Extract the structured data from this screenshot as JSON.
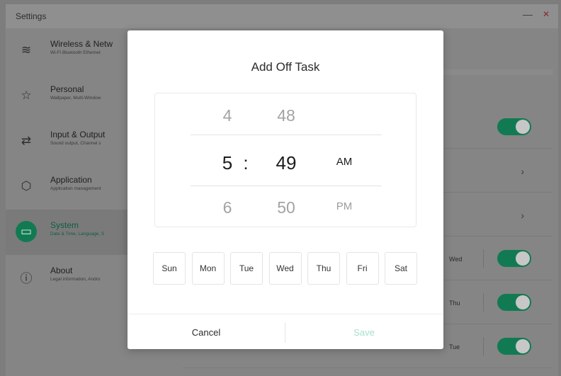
{
  "window": {
    "title": "Settings",
    "minimize_glyph": "—",
    "close_glyph": "✕"
  },
  "sidebar": {
    "items": [
      {
        "icon": "wifi-icon",
        "glyph": "≋",
        "label": "Wireless & Netw",
        "subtitle": "Wi-Fi Bluetooth Ethernet"
      },
      {
        "icon": "star-icon",
        "glyph": "☆",
        "label": "Personal",
        "subtitle": "Wallpaper, Multi-Window"
      },
      {
        "icon": "input-output-icon",
        "glyph": "⇄",
        "label": "Input & Output",
        "subtitle": "Sound output, Channel s"
      },
      {
        "icon": "application-icon",
        "glyph": "⬡",
        "label": "Application",
        "subtitle": "Application management"
      },
      {
        "icon": "monitor-icon",
        "glyph": "▭",
        "label": "System",
        "subtitle": "Date & Time, Language, S",
        "active": true
      },
      {
        "icon": "info-icon",
        "glyph": "ⓘ",
        "label": "About",
        "subtitle": "Legal information, Andro"
      }
    ]
  },
  "content": {
    "rows": [
      {
        "type": "toggle",
        "on": true
      },
      {
        "type": "chevron",
        "glyph": "›"
      },
      {
        "type": "chevron",
        "glyph": "›"
      },
      {
        "type": "task",
        "day": "Wed",
        "on": true
      },
      {
        "type": "task",
        "day": "Thu",
        "on": true
      },
      {
        "type": "task",
        "day": "Tue",
        "on": true
      }
    ]
  },
  "dialog": {
    "title": "Add Off Task",
    "picker": {
      "hours": [
        "4",
        "5",
        "6"
      ],
      "minutes": [
        "48",
        "49",
        "50"
      ],
      "separator": ":",
      "ampm": [
        "AM",
        "PM"
      ],
      "selected": {
        "hour": "5",
        "minute": "49",
        "ampm": "AM"
      }
    },
    "days": [
      "Sun",
      "Mon",
      "Tue",
      "Wed",
      "Thu",
      "Fri",
      "Sat"
    ],
    "cancel_label": "Cancel",
    "save_label": "Save"
  },
  "colors": {
    "accent": "#127a52",
    "save_disabled": "#a8e0cb",
    "overlay": "#7d7d7d"
  }
}
